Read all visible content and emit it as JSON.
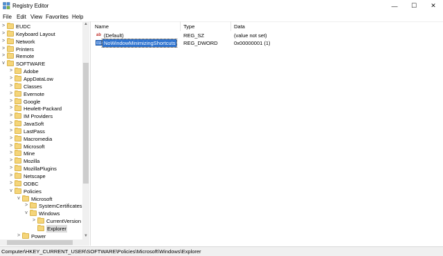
{
  "window": {
    "title": "Registry Editor",
    "minimize": "—",
    "maximize": "☐",
    "close": "✕"
  },
  "menu": [
    "File",
    "Edit",
    "View",
    "Favorites",
    "Help"
  ],
  "tree": [
    {
      "label": "EUDC",
      "depth": 1,
      "chevron": ">"
    },
    {
      "label": "Keyboard Layout",
      "depth": 1,
      "chevron": ">"
    },
    {
      "label": "Network",
      "depth": 1,
      "chevron": ">"
    },
    {
      "label": "Printers",
      "depth": 1,
      "chevron": ">"
    },
    {
      "label": "Remote",
      "depth": 1,
      "chevron": ">"
    },
    {
      "label": "SOFTWARE",
      "depth": 1,
      "chevron": "v"
    },
    {
      "label": "Adobe",
      "depth": 2,
      "chevron": ">"
    },
    {
      "label": "AppDataLow",
      "depth": 2,
      "chevron": ">"
    },
    {
      "label": "Classes",
      "depth": 2,
      "chevron": ">"
    },
    {
      "label": "Evernote",
      "depth": 2,
      "chevron": ">"
    },
    {
      "label": "Google",
      "depth": 2,
      "chevron": ">"
    },
    {
      "label": "Hewlett-Packard",
      "depth": 2,
      "chevron": ">"
    },
    {
      "label": "IM Providers",
      "depth": 2,
      "chevron": ">"
    },
    {
      "label": "JavaSoft",
      "depth": 2,
      "chevron": ">"
    },
    {
      "label": "LastPass",
      "depth": 2,
      "chevron": ">"
    },
    {
      "label": "Macromedia",
      "depth": 2,
      "chevron": ">"
    },
    {
      "label": "Microsoft",
      "depth": 2,
      "chevron": ">"
    },
    {
      "label": "Mine",
      "depth": 2,
      "chevron": ">"
    },
    {
      "label": "Mozilla",
      "depth": 2,
      "chevron": ">"
    },
    {
      "label": "MozillaPlugins",
      "depth": 2,
      "chevron": ">"
    },
    {
      "label": "Netscape",
      "depth": 2,
      "chevron": ">"
    },
    {
      "label": "ODBC",
      "depth": 2,
      "chevron": ">"
    },
    {
      "label": "Policies",
      "depth": 2,
      "chevron": "v"
    },
    {
      "label": "Microsoft",
      "depth": 3,
      "chevron": "v"
    },
    {
      "label": "SystemCertificates",
      "depth": 4,
      "chevron": ">"
    },
    {
      "label": "Windows",
      "depth": 4,
      "chevron": "v"
    },
    {
      "label": "CurrentVersion",
      "depth": 5,
      "chevron": ">"
    },
    {
      "label": "Explorer",
      "depth": 5,
      "chevron": "",
      "selected": true
    },
    {
      "label": "Power",
      "depth": 3,
      "chevron": ">"
    }
  ],
  "columns": {
    "name": "Name",
    "type": "Type",
    "data": "Data"
  },
  "values": [
    {
      "icon": "ab",
      "name": "(Default)",
      "type": "REG_SZ",
      "data": "(value not set)"
    },
    {
      "icon": "011",
      "name": "NoWindowMinimizingShortcuts",
      "type": "REG_DWORD",
      "data": "0x00000001 (1)",
      "selected": true
    }
  ],
  "status": "Computer\\HKEY_CURRENT_USER\\SOFTWARE\\Policies\\Microsoft\\Windows\\Explorer"
}
